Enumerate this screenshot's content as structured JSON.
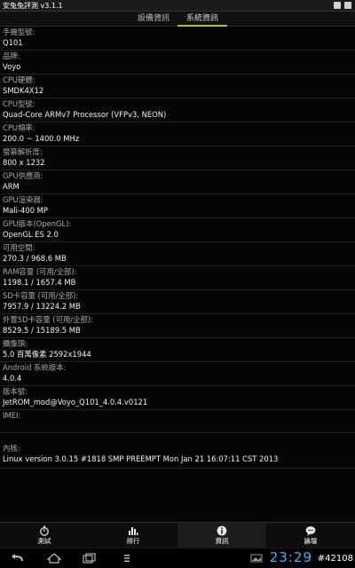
{
  "app": {
    "title": "安兔兔評測 v3.1.1"
  },
  "tabs": [
    {
      "label": "設備資訊"
    },
    {
      "label": "系統資訊"
    }
  ],
  "info": [
    {
      "label": "手機型號:",
      "value": "Q101"
    },
    {
      "label": "品牌:",
      "value": "Voyo"
    },
    {
      "label": "CPU硬體:",
      "value": "SMDK4X12"
    },
    {
      "label": "CPU型號:",
      "value": "Quad-Core ARMv7 Processor (VFPv3, NEON)"
    },
    {
      "label": "CPU頻率:",
      "value": "200.0 ~ 1400.0 MHz"
    },
    {
      "label": "螢幕解析度:",
      "value": "800 x 1232"
    },
    {
      "label": "GPU供應商:",
      "value": "ARM"
    },
    {
      "label": "GPU渲染器:",
      "value": "Mali-400 MP"
    },
    {
      "label": "GPU版本(OpenGL):",
      "value": "OpenGL ES 2.0"
    },
    {
      "label": "可用空間:",
      "value": "270.3 / 968.6 MB"
    },
    {
      "label": "RAM容量 (可用/全部):",
      "value": "1198.1 / 1657.4 MB"
    },
    {
      "label": "SD卡容量 (可用/全部):",
      "value": "7957.9 / 13224.2 MB"
    },
    {
      "label": "外置SD卡容量 (可用/全部):",
      "value": "8529.5 / 15189.5 MB"
    },
    {
      "label": "攝像頭:",
      "value": "5.0 百萬像素   2592x1944"
    },
    {
      "label": "Android 系統版本:",
      "value": "4.0.4"
    },
    {
      "label": "版本號:",
      "value": "JetROM_mod@Voyo_Q101_4.0.4.v0121"
    },
    {
      "label": "IMEI:",
      "value": ""
    },
    {
      "label": "內核:",
      "value": "Linux version 3.0.15 #1818 SMP PREEMPT Mon Jan 21 16:07:11 CST 2013"
    }
  ],
  "actions": [
    {
      "label": "測試",
      "icon": "stopwatch-icon"
    },
    {
      "label": "排行",
      "icon": "bar-chart-icon"
    },
    {
      "label": "資訊",
      "icon": "info-icon"
    },
    {
      "label": "論壇",
      "icon": "chat-bubble-icon"
    }
  ],
  "system": {
    "clock": "23:29",
    "watermark": "#42108"
  }
}
